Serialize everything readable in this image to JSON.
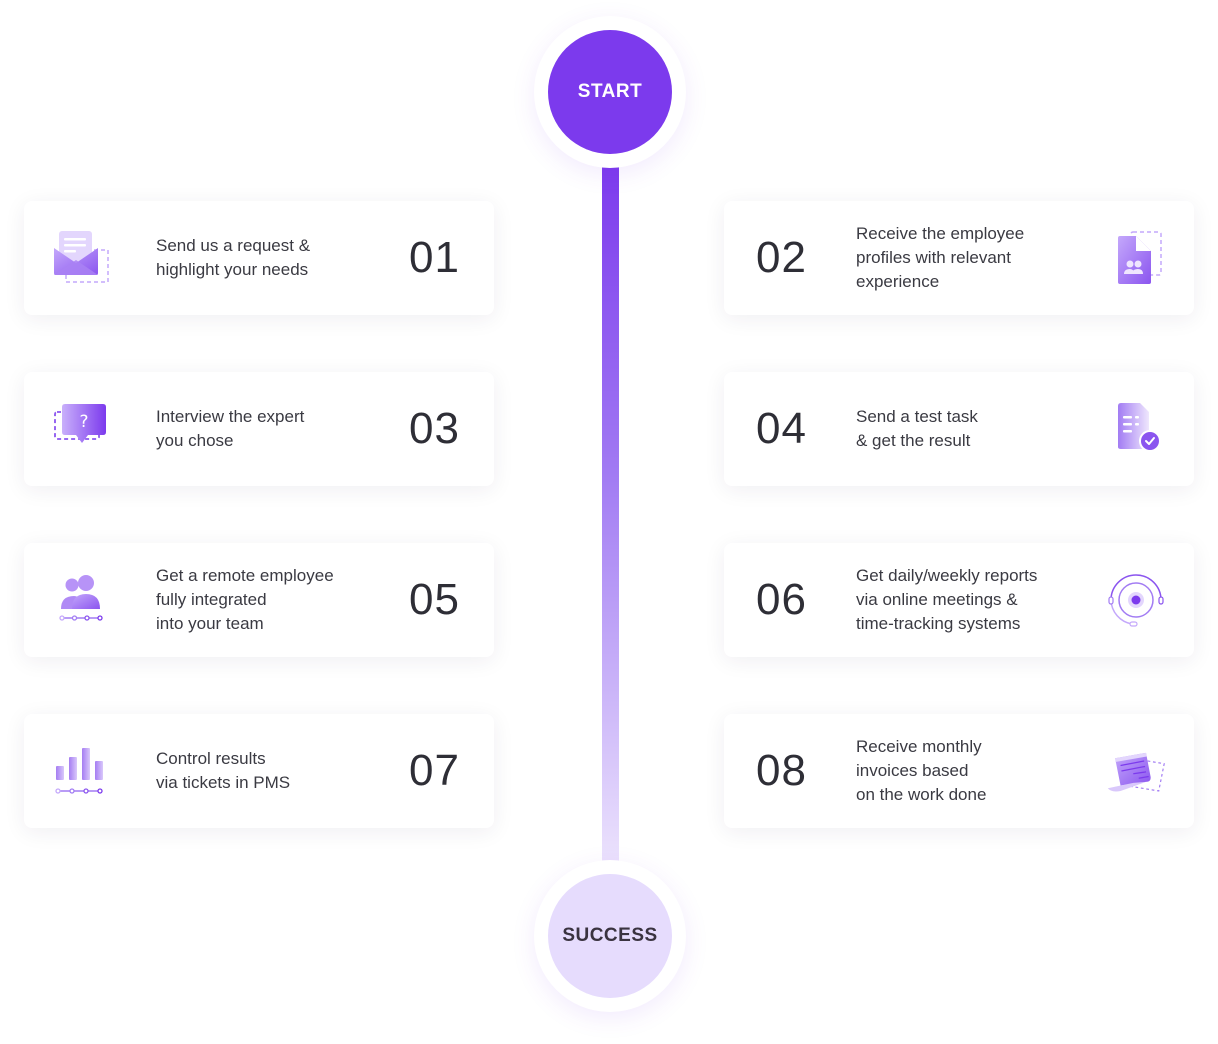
{
  "timeline": {
    "start_label": "START",
    "end_label": "SUCCESS",
    "colors": {
      "accent": "#7c3aed",
      "accent_light": "#e6dcfd",
      "text": "#2e2e36"
    }
  },
  "steps": [
    {
      "number": "01",
      "text": "Send us a request &\nhighlight your needs",
      "icon": "envelope-icon",
      "side": "left"
    },
    {
      "number": "02",
      "text": "Receive the employee\nprofiles with relevant\nexperience",
      "icon": "profile-document-icon",
      "side": "right"
    },
    {
      "number": "03",
      "text": "Interview the expert\nyou chose",
      "icon": "question-chat-icon",
      "side": "left"
    },
    {
      "number": "04",
      "text": "Send a test task\n& get the result",
      "icon": "checked-document-icon",
      "side": "right"
    },
    {
      "number": "05",
      "text": "Get a remote employee\nfully integrated\ninto your team",
      "icon": "team-icon",
      "side": "left"
    },
    {
      "number": "06",
      "text": "Get daily/weekly reports\nvia online meetings &\ntime-tracking systems",
      "icon": "headset-icon",
      "side": "right"
    },
    {
      "number": "07",
      "text": "Control results\nvia tickets in PMS",
      "icon": "bar-chart-icon",
      "side": "left"
    },
    {
      "number": "08",
      "text": "Receive monthly\ninvoices based\non the work done",
      "icon": "invoice-icon",
      "side": "right"
    }
  ]
}
